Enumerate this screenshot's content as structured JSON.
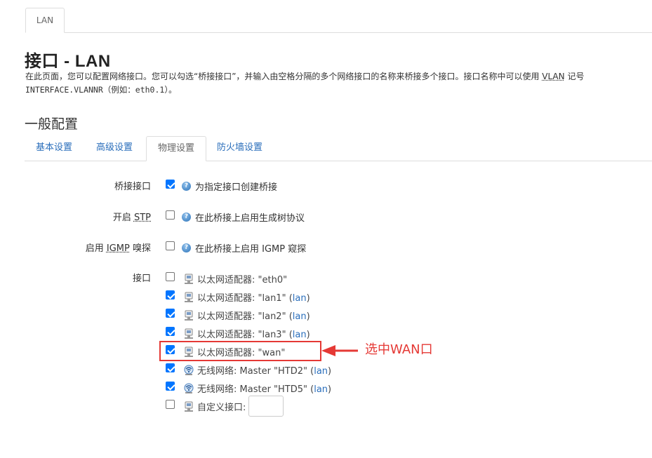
{
  "top_tab": {
    "label": "LAN"
  },
  "header": {
    "title": "接口 - LAN",
    "desc_part1": "在此页面，您可以配置网络接口。您可以勾选“桥接接口”，并输入由空格分隔的多个网络接口的名称来桥接多个接口。接口名称中可以使用 ",
    "desc_vlan": "VLAN",
    "desc_part2": " 记号",
    "desc_mono": "INTERFACE.VLANNR（例如：eth0.1）。"
  },
  "section": {
    "title": "一般配置"
  },
  "sub_tabs": [
    {
      "label": "基本设置",
      "active": false
    },
    {
      "label": "高级设置",
      "active": false
    },
    {
      "label": "物理设置",
      "active": true
    },
    {
      "label": "防火墙设置",
      "active": false
    }
  ],
  "bridge": {
    "label": "桥接接口",
    "checked": true,
    "help": "为指定接口创建桥接"
  },
  "stp": {
    "label_pre": "开启 ",
    "label_abbr": "STP",
    "checked": false,
    "help": "在此桥接上启用生成树协议"
  },
  "igmp": {
    "label_pre": "启用 ",
    "label_abbr": "IGMP",
    "label_post": " 嗅探",
    "checked": false,
    "help": "在此桥接上启用 IGMP 窥探"
  },
  "interfaces": {
    "label": "接口",
    "items": [
      {
        "type": "ethernet",
        "text": "以太网适配器: \"eth0\"",
        "net": "",
        "checked": false
      },
      {
        "type": "ethernet",
        "text": "以太网适配器: \"lan1\"",
        "net": "lan",
        "checked": true
      },
      {
        "type": "ethernet",
        "text": "以太网适配器: \"lan2\"",
        "net": "lan",
        "checked": true
      },
      {
        "type": "ethernet",
        "text": "以太网适配器: \"lan3\"",
        "net": "lan",
        "checked": true
      },
      {
        "type": "ethernet",
        "text": "以太网适配器: \"wan\"",
        "net": "",
        "checked": true
      },
      {
        "type": "wireless",
        "text": "无线网络: Master \"HTD2\"",
        "net": "lan",
        "checked": true
      },
      {
        "type": "wireless",
        "text": "无线网络: Master \"HTD5\"",
        "net": "lan",
        "checked": true
      },
      {
        "type": "custom",
        "text": "自定义接口:",
        "net": "",
        "checked": false
      }
    ],
    "custom_value": ""
  },
  "annotation": {
    "text": "选中WAN口",
    "color": "#e53935"
  },
  "colors": {
    "link": "#2a6ebb",
    "checkbox": "#0075ff"
  }
}
